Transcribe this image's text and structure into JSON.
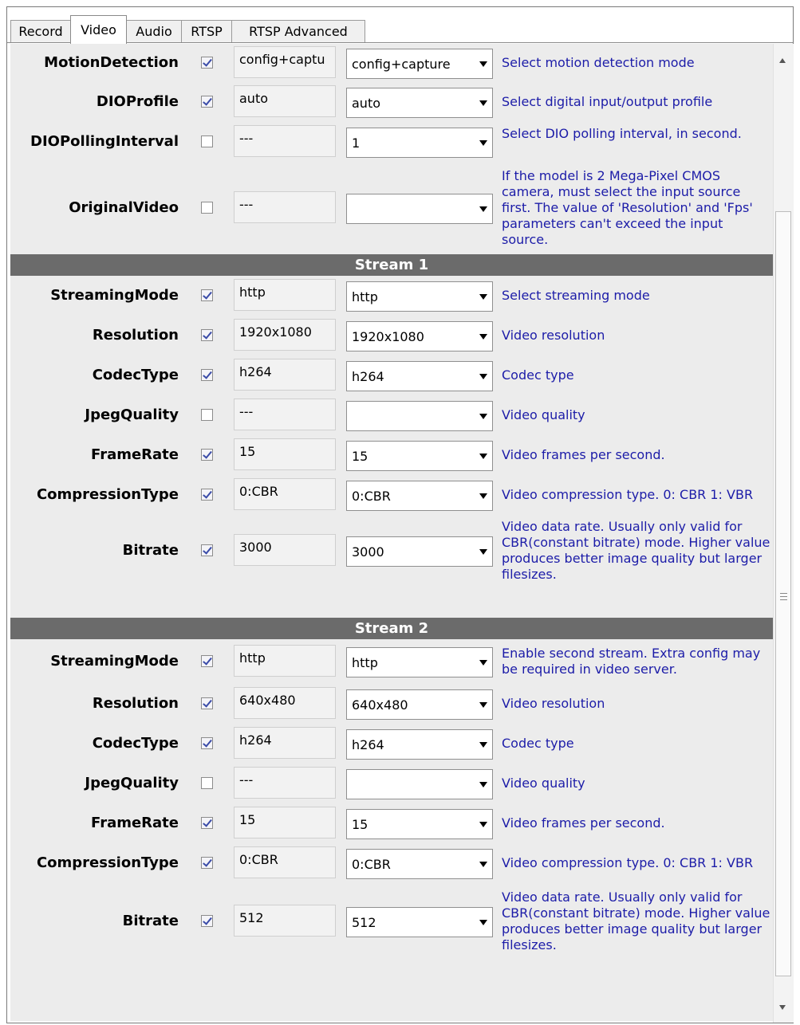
{
  "tabs": [
    "Record",
    "Video",
    "Audio",
    "RTSP",
    "RTSP Advanced"
  ],
  "active_tab": "Video",
  "general_rows": [
    {
      "label": "MotionDetection",
      "checked": true,
      "current": "config+captu",
      "selected": "config+capture",
      "desc": "Select motion detection mode"
    },
    {
      "label": "DIOProfile",
      "checked": true,
      "current": "auto",
      "selected": "auto",
      "desc": "Select digital input/output profile"
    },
    {
      "label": "DIOPollingInterval",
      "checked": false,
      "current": "---",
      "selected": "1",
      "desc": "Select DIO polling interval, in second."
    },
    {
      "label": "OriginalVideo",
      "checked": false,
      "current": "---",
      "selected": "",
      "desc": "If the model is 2 Mega-Pixel CMOS camera, must select the input source first. The value of 'Resolution' and 'Fps' parameters can't exceed the input source."
    }
  ],
  "stream1": {
    "title": "Stream 1",
    "rows": [
      {
        "label": "StreamingMode",
        "checked": true,
        "current": "http",
        "selected": "http",
        "desc": "Select streaming mode"
      },
      {
        "label": "Resolution",
        "checked": true,
        "current": "1920x1080",
        "selected": "1920x1080",
        "desc": "Video resolution"
      },
      {
        "label": "CodecType",
        "checked": true,
        "current": "h264",
        "selected": "h264",
        "desc": "Codec type"
      },
      {
        "label": "JpegQuality",
        "checked": false,
        "current": "---",
        "selected": "",
        "desc": "Video quality"
      },
      {
        "label": "FrameRate",
        "checked": true,
        "current": "15",
        "selected": "15",
        "desc": "Video frames per second."
      },
      {
        "label": "CompressionType",
        "checked": true,
        "current": "0:CBR",
        "selected": "0:CBR",
        "desc": "Video compression type. 0: CBR 1: VBR"
      },
      {
        "label": "Bitrate",
        "checked": true,
        "current": "3000",
        "selected": "3000",
        "desc": "Video data rate. Usually only valid for CBR(constant bitrate) mode. Higher value produces better image quality but larger filesizes."
      }
    ]
  },
  "stream2": {
    "title": "Stream 2",
    "rows": [
      {
        "label": "StreamingMode",
        "checked": true,
        "current": "http",
        "selected": "http",
        "desc": "Enable second stream. Extra config may be required in video server."
      },
      {
        "label": "Resolution",
        "checked": true,
        "current": "640x480",
        "selected": "640x480",
        "desc": "Video resolution"
      },
      {
        "label": "CodecType",
        "checked": true,
        "current": "h264",
        "selected": "h264",
        "desc": "Codec type"
      },
      {
        "label": "JpegQuality",
        "checked": false,
        "current": "---",
        "selected": "",
        "desc": "Video quality"
      },
      {
        "label": "FrameRate",
        "checked": true,
        "current": "15",
        "selected": "15",
        "desc": "Video frames per second."
      },
      {
        "label": "CompressionType",
        "checked": true,
        "current": "0:CBR",
        "selected": "0:CBR",
        "desc": "Video compression type. 0: CBR 1: VBR"
      },
      {
        "label": "Bitrate",
        "checked": true,
        "current": "512",
        "selected": "512",
        "desc": "Video data rate. Usually only valid for CBR(constant bitrate) mode. Higher value produces better image quality but larger filesizes."
      }
    ]
  },
  "colors": {
    "header_bg": "#6b6b6b",
    "desc_text": "#1c1ca8",
    "panel_bg": "#ececec"
  },
  "icons": [
    "checkbox-checked-icon",
    "dropdown-arrow-icon",
    "scroll-up-icon",
    "scroll-down-icon",
    "scroll-grip-icon"
  ]
}
